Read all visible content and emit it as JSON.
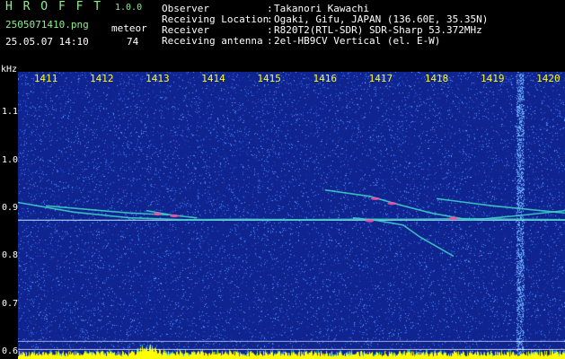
{
  "header": {
    "app_title": "H R O F F T",
    "version": "1.0.0",
    "filename": "2505071410.png",
    "timestamp": "25.05.07 14:10",
    "meteor_label": "meteor",
    "meteor_count": "74"
  },
  "info": [
    {
      "label": "Observer",
      "value": "Takanori Kawachi"
    },
    {
      "label": "Receiving Location",
      "value": "Ogaki, Gifu, JAPAN (136.60E, 35.35N)"
    },
    {
      "label": "Receiver",
      "value": "R820T2(RTL-SDR) SDR-Sharp 53.372MHz"
    },
    {
      "label": "Receiving antenna",
      "value": "2el-HB9CV Vertical (el. E-W)"
    }
  ],
  "colors": {
    "background": "#10248f",
    "noise": "#3a7bff",
    "trace": "#3dd6c8",
    "hot": "#ff4fa0",
    "time_labels": "#ffff00",
    "title": "#8df08d"
  },
  "chart_data": {
    "type": "heatmap",
    "ylabel": "kHz",
    "x_ticks": [
      "1411",
      "1412",
      "1413",
      "1414",
      "1415",
      "1416",
      "1417",
      "1418",
      "1419",
      "1420"
    ],
    "y_ticks": [
      "1.1",
      "1.0",
      "0.9",
      "0.8",
      "0.7",
      "0.6"
    ],
    "xlim": [
      1410.5,
      1420.3
    ],
    "ylim": [
      0.585,
      1.185
    ],
    "reference_lines_khz": [
      0.875,
      0.622,
      0.605
    ],
    "traces": [
      {
        "points": [
          [
            1410.5,
            0.912
          ],
          [
            1411.5,
            0.892
          ],
          [
            1412.5,
            0.88
          ],
          [
            1413.5,
            0.876
          ],
          [
            1414.5,
            0.877
          ],
          [
            1415.5,
            0.876
          ],
          [
            1416.5,
            0.877
          ],
          [
            1417.5,
            0.877
          ],
          [
            1418.5,
            0.878
          ],
          [
            1420.3,
            0.876
          ]
        ]
      },
      {
        "points": [
          [
            1411.0,
            0.905
          ],
          [
            1412.5,
            0.89
          ],
          [
            1413.2,
            0.886
          ]
        ]
      },
      {
        "points": [
          [
            1416.0,
            0.938
          ],
          [
            1416.8,
            0.925
          ],
          [
            1417.4,
            0.905
          ],
          [
            1417.9,
            0.89
          ],
          [
            1418.6,
            0.875
          ],
          [
            1419.5,
            0.885
          ],
          [
            1420.3,
            0.895
          ]
        ]
      },
      {
        "points": [
          [
            1416.5,
            0.88
          ],
          [
            1416.9,
            0.875
          ],
          [
            1417.4,
            0.865
          ],
          [
            1417.7,
            0.84
          ],
          [
            1418.0,
            0.82
          ],
          [
            1418.3,
            0.8
          ]
        ]
      },
      {
        "points": [
          [
            1418.0,
            0.92
          ],
          [
            1419.0,
            0.905
          ],
          [
            1420.3,
            0.89
          ]
        ]
      },
      {
        "points": [
          [
            1412.8,
            0.895
          ],
          [
            1413.3,
            0.885
          ],
          [
            1413.7,
            0.88
          ]
        ]
      }
    ],
    "hot_spots": [
      [
        1413.0,
        0.888
      ],
      [
        1413.3,
        0.884
      ],
      [
        1416.9,
        0.92
      ],
      [
        1417.2,
        0.91
      ],
      [
        1416.8,
        0.874
      ],
      [
        1418.3,
        0.879
      ]
    ],
    "bottom_spectrum_note": "",
    "vertical_noise_band_x": 1419.5
  }
}
